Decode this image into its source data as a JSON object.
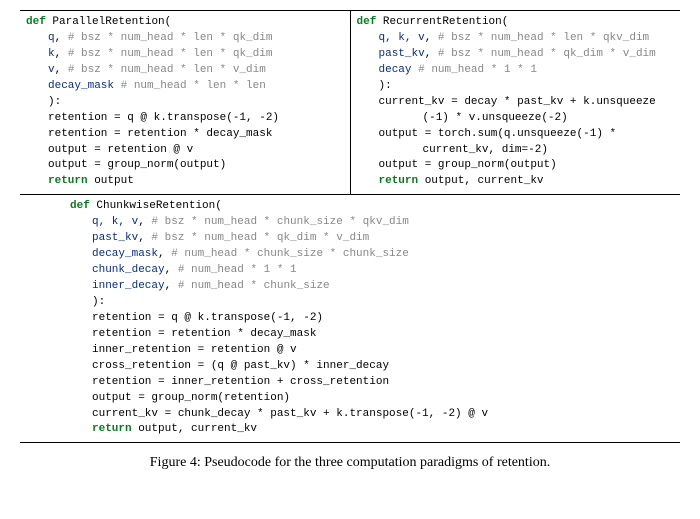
{
  "parallel": {
    "name": "ParallelRetention",
    "params": [
      {
        "n": "q",
        "c": "# bsz * num_head * len * qk_dim"
      },
      {
        "n": "k",
        "c": "# bsz * num_head * len * qk_dim"
      },
      {
        "n": "v",
        "c": "# bsz * num_head * len * v_dim"
      },
      {
        "n": "decay_mask",
        "c": "# num_head * len * len"
      }
    ],
    "body": [
      "retention = q @ k.transpose(-1, -2)",
      "retention = retention * decay_mask",
      "output = retention @ v",
      "output = group_norm(output)"
    ],
    "ret": "return output"
  },
  "recurrent": {
    "name": "RecurrentRetention",
    "params": [
      {
        "n": "q, k, v",
        "c": "# bsz * num_head * len * qkv_dim"
      },
      {
        "n": "past_kv",
        "c": "# bsz * num_head * qk_dim * v_dim"
      },
      {
        "n": "decay",
        "c": "# num_head * 1 * 1"
      }
    ],
    "body": [
      {
        "l": "current_kv = decay * past_kv + k.unsqueeze",
        "cont": "(-1) * v.unsqueeze(-2)"
      },
      {
        "l": "output = torch.sum(q.unsqueeze(-1) *",
        "cont": "current_kv, dim=-2)"
      },
      {
        "l": "output = group_norm(output)"
      }
    ],
    "ret": "return output, current_kv"
  },
  "chunkwise": {
    "name": "ChunkwiseRetention",
    "params": [
      {
        "n": "q, k, v",
        "c": "# bsz * num_head * chunk_size * qkv_dim"
      },
      {
        "n": "past_kv",
        "c": "# bsz * num_head * qk_dim * v_dim"
      },
      {
        "n": "decay_mask",
        "c": "# num_head * chunk_size * chunk_size"
      },
      {
        "n": "chunk_decay",
        "c": "# num_head * 1 * 1"
      },
      {
        "n": "inner_decay",
        "c": "# num_head * chunk_size"
      }
    ],
    "body": [
      "retention = q @ k.transpose(-1, -2)",
      "retention = retention * decay_mask",
      "inner_retention = retention @ v",
      "cross_retention = (q @ past_kv) * inner_decay",
      "retention = inner_retention + cross_retention",
      "output = group_norm(retention)",
      "current_kv = chunk_decay * past_kv + k.transpose(-1, -2) @ v"
    ],
    "ret": "return output, current_kv"
  },
  "kw": {
    "def": "def",
    "ret": "return"
  },
  "caption": "Figure 4: Pseudocode for the three computation paradigms of retention."
}
